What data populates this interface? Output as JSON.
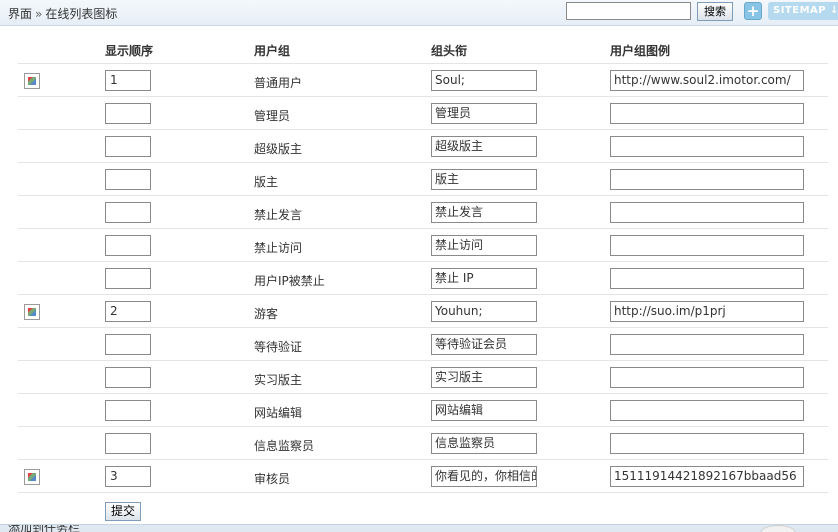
{
  "header": {
    "breadcrumb_root": "界面",
    "breadcrumb_sep": "»",
    "breadcrumb_current": "在线列表图标",
    "search_value": "",
    "search_button": "搜索",
    "plus_label": "+",
    "sitemap_label": "SITEMAP ↓"
  },
  "columns": {
    "order": "显示顺序",
    "group": "用户组",
    "title": "组头衔",
    "icon": "用户组图例"
  },
  "rows": [
    {
      "has_image": true,
      "order": "1",
      "group": "普通用户",
      "title": "Soul;",
      "icon": "http://www.soul2.imotor.com/"
    },
    {
      "has_image": false,
      "order": "",
      "group": "管理员",
      "title": "管理员",
      "icon": ""
    },
    {
      "has_image": false,
      "order": "",
      "group": "超级版主",
      "title": "超级版主",
      "icon": ""
    },
    {
      "has_image": false,
      "order": "",
      "group": "版主",
      "title": "版主",
      "icon": ""
    },
    {
      "has_image": false,
      "order": "",
      "group": "禁止发言",
      "title": "禁止发言",
      "icon": ""
    },
    {
      "has_image": false,
      "order": "",
      "group": "禁止访问",
      "title": "禁止访问",
      "icon": ""
    },
    {
      "has_image": false,
      "order": "",
      "group": "用户IP被禁止",
      "title": "禁止 IP",
      "icon": ""
    },
    {
      "has_image": true,
      "order": "2",
      "group": "游客",
      "title": "Youhun;",
      "icon": "http://suo.im/p1prj"
    },
    {
      "has_image": false,
      "order": "",
      "group": "等待验证",
      "title": "等待验证会员",
      "icon": ""
    },
    {
      "has_image": false,
      "order": "",
      "group": "实习版主",
      "title": "实习版主",
      "icon": ""
    },
    {
      "has_image": false,
      "order": "",
      "group": "网站编辑",
      "title": "网站编辑",
      "icon": ""
    },
    {
      "has_image": false,
      "order": "",
      "group": "信息监察员",
      "title": "信息监察员",
      "icon": ""
    },
    {
      "has_image": true,
      "order": "3",
      "group": "审核员",
      "title": "你看见的，你相信的",
      "icon": "15111914421892167bbaad56"
    }
  ],
  "submit_label": "提交",
  "footer_label": "添加到任务栏"
}
